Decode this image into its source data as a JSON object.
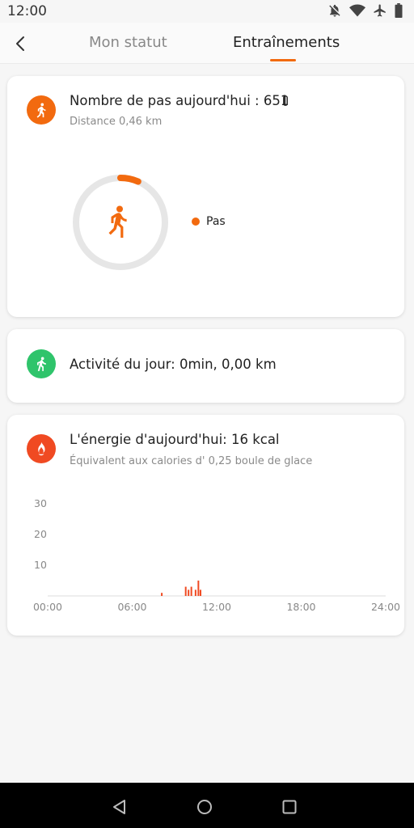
{
  "status_bar": {
    "time": "12:00"
  },
  "header": {
    "tabs": [
      {
        "label": "Mon statut"
      },
      {
        "label": "Entraînements"
      }
    ]
  },
  "steps_card": {
    "title": "Nombre de pas aujourd'hui : 651",
    "subtitle": "Distance 0,46 km",
    "legend_label": "Pas",
    "progress": 0.065,
    "accent_color": "#f26a0f"
  },
  "activity_card": {
    "title": "Activité du jour: 0min, 0,00 km",
    "accent_color": "#2fc46b"
  },
  "energy_card": {
    "title": "L'énergie d'aujourd'hui: 16 kcal",
    "subtitle": "Équivalent aux calories d' 0,25 boule de glace",
    "accent_color": "#f04a22"
  },
  "chart_data": {
    "type": "bar",
    "title": "",
    "xlabel": "",
    "ylabel": "",
    "ylim": [
      0,
      30
    ],
    "yticks": [
      "10",
      "20",
      "30"
    ],
    "xticks": [
      "00:00",
      "06:00",
      "12:00",
      "18:00",
      "24:00"
    ],
    "xlim_hours": [
      0,
      24
    ],
    "bar_color": "#f04a22",
    "points": [
      {
        "hour": 8.1,
        "value": 1
      },
      {
        "hour": 9.8,
        "value": 3
      },
      {
        "hour": 10.0,
        "value": 2
      },
      {
        "hour": 10.2,
        "value": 3
      },
      {
        "hour": 10.5,
        "value": 2
      },
      {
        "hour": 10.7,
        "value": 5
      },
      {
        "hour": 10.85,
        "value": 2
      }
    ]
  }
}
